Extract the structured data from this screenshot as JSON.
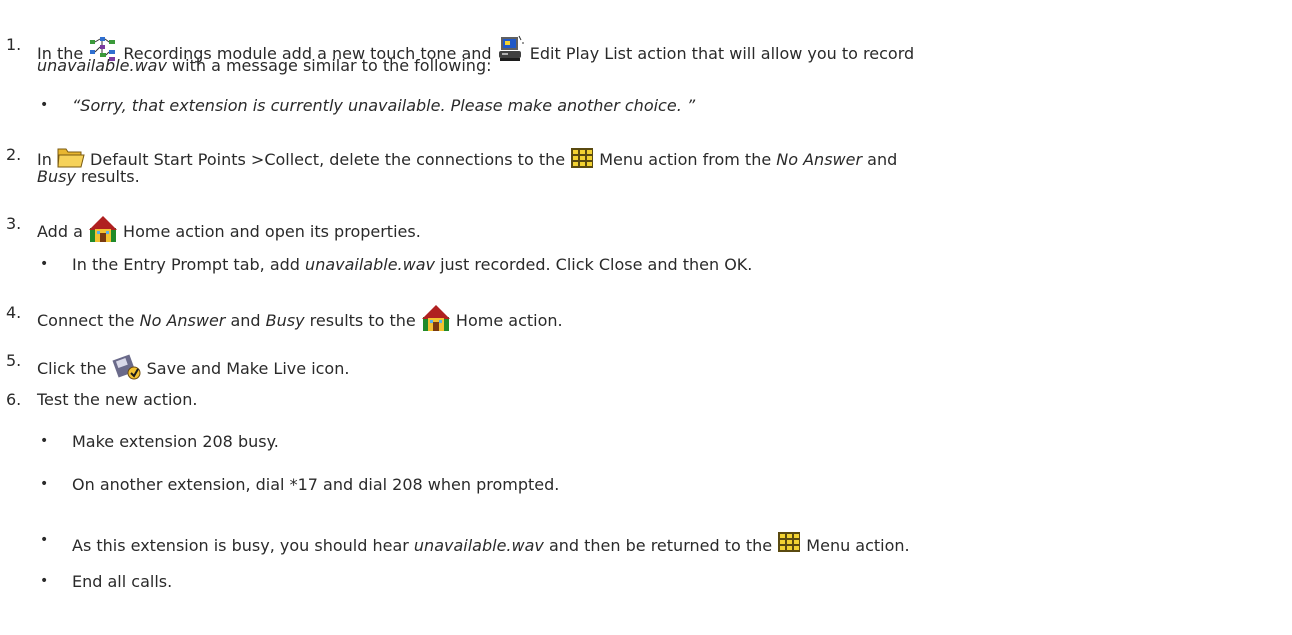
{
  "steps": [
    {
      "number": "1.",
      "line1": {
        "t1": "In the ",
        "icon1": "recordings-module-icon",
        "t2": " Recordings module add a new touch tone and ",
        "icon2": "edit-play-list-icon",
        "t3": " Edit Play List action that will allow you to record"
      },
      "line2": {
        "em1": "unavailable.wav",
        "t1": " with a message similar to the following:"
      },
      "bullets": [
        "“Sorry, that extension is currently unavailable. Please make another choice. ”"
      ]
    },
    {
      "number": "2.",
      "line1": {
        "t1": "In ",
        "icon1": "folder-icon",
        "t2": " Default Start Points >Collect, delete the connections to the ",
        "icon2": "menu-action-icon",
        "t3": " Menu action from the ",
        "em1": "No Answer",
        "t4": " and"
      },
      "line2": {
        "em1": "Busy",
        "t1": " results."
      }
    },
    {
      "number": "3.",
      "line1": {
        "t1": "Add a ",
        "icon1": "home-action-icon",
        "t2": " Home action and open its properties."
      },
      "bullets": [
        {
          "t1": "In the Entry Prompt tab, add ",
          "em1": "unavailable.wav",
          "t2": " just recorded. Click Close and then OK."
        }
      ]
    },
    {
      "number": "4.",
      "line1": {
        "t1": "Connect the ",
        "em1": "No Answer",
        "t2": " and ",
        "em2": "Busy",
        "t3": " results to the ",
        "icon1": "home-action-icon",
        "t4": " Home action."
      }
    },
    {
      "number": "5.",
      "line1": {
        "t1": "Click the ",
        "icon1": "save-and-make-live-icon",
        "t2": " Save and Make Live icon."
      }
    },
    {
      "number": "6.",
      "line1": {
        "t1": "Test the new action."
      },
      "bullets": [
        "Make extension 208 busy.",
        "On another extension, dial *17 and dial 208 when prompted.",
        {
          "t1": "As this extension is busy, you should hear ",
          "em1": "unavailable.wav",
          "t2": " and then be returned to the ",
          "icon1": "menu-action-icon",
          "t3": " Menu action."
        },
        "End all calls."
      ]
    }
  ],
  "bullet_char": "•"
}
